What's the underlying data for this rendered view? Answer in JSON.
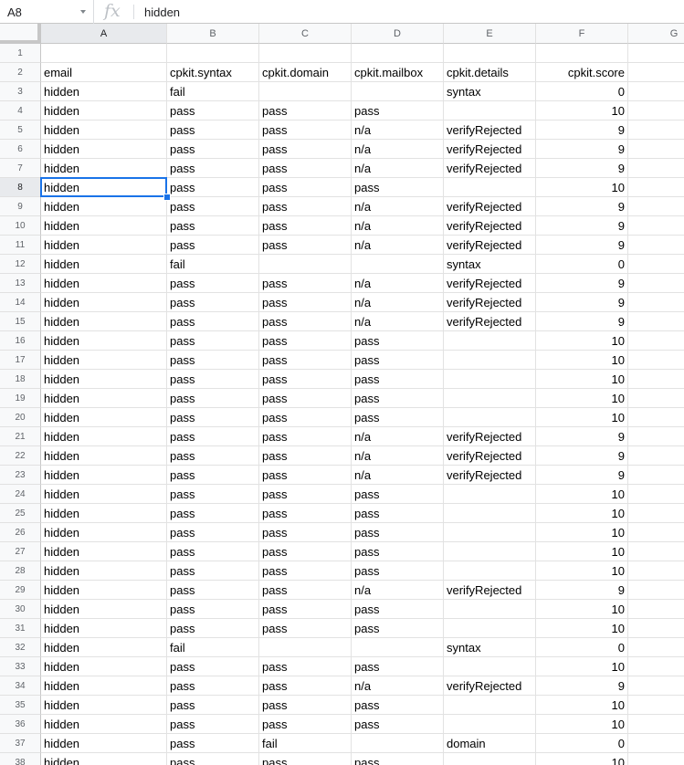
{
  "formula_bar": {
    "name_box": "A8",
    "fx_label": "fx",
    "value": "hidden"
  },
  "sheet": {
    "columns": [
      "A",
      "B",
      "C",
      "D",
      "E",
      "F",
      "G"
    ],
    "active_column": "A",
    "active_row": 8,
    "selected_cell": "A8",
    "rows": [
      {
        "n": "1",
        "cells": [
          "",
          "",
          "",
          "",
          "",
          ""
        ]
      },
      {
        "n": "2",
        "cells": [
          "email",
          "cpkit.syntax",
          "cpkit.domain",
          "cpkit.mailbox",
          "cpkit.details",
          "cpkit.score"
        ]
      },
      {
        "n": "3",
        "cells": [
          "hidden",
          "fail",
          "",
          "",
          "syntax",
          "0"
        ]
      },
      {
        "n": "4",
        "cells": [
          "hidden",
          "pass",
          "pass",
          "pass",
          "",
          "10"
        ]
      },
      {
        "n": "5",
        "cells": [
          "hidden",
          "pass",
          "pass",
          "n/a",
          "verifyRejected",
          "9"
        ]
      },
      {
        "n": "6",
        "cells": [
          "hidden",
          "pass",
          "pass",
          "n/a",
          "verifyRejected",
          "9"
        ]
      },
      {
        "n": "7",
        "cells": [
          "hidden",
          "pass",
          "pass",
          "n/a",
          "verifyRejected",
          "9"
        ]
      },
      {
        "n": "8",
        "cells": [
          "hidden",
          "pass",
          "pass",
          "pass",
          "",
          "10"
        ]
      },
      {
        "n": "9",
        "cells": [
          "hidden",
          "pass",
          "pass",
          "n/a",
          "verifyRejected",
          "9"
        ]
      },
      {
        "n": "10",
        "cells": [
          "hidden",
          "pass",
          "pass",
          "n/a",
          "verifyRejected",
          "9"
        ]
      },
      {
        "n": "11",
        "cells": [
          "hidden",
          "pass",
          "pass",
          "n/a",
          "verifyRejected",
          "9"
        ]
      },
      {
        "n": "12",
        "cells": [
          "hidden",
          "fail",
          "",
          "",
          "syntax",
          "0"
        ]
      },
      {
        "n": "13",
        "cells": [
          "hidden",
          "pass",
          "pass",
          "n/a",
          "verifyRejected",
          "9"
        ]
      },
      {
        "n": "14",
        "cells": [
          "hidden",
          "pass",
          "pass",
          "n/a",
          "verifyRejected",
          "9"
        ]
      },
      {
        "n": "15",
        "cells": [
          "hidden",
          "pass",
          "pass",
          "n/a",
          "verifyRejected",
          "9"
        ]
      },
      {
        "n": "16",
        "cells": [
          "hidden",
          "pass",
          "pass",
          "pass",
          "",
          "10"
        ]
      },
      {
        "n": "17",
        "cells": [
          "hidden",
          "pass",
          "pass",
          "pass",
          "",
          "10"
        ]
      },
      {
        "n": "18",
        "cells": [
          "hidden",
          "pass",
          "pass",
          "pass",
          "",
          "10"
        ]
      },
      {
        "n": "19",
        "cells": [
          "hidden",
          "pass",
          "pass",
          "pass",
          "",
          "10"
        ]
      },
      {
        "n": "20",
        "cells": [
          "hidden",
          "pass",
          "pass",
          "pass",
          "",
          "10"
        ]
      },
      {
        "n": "21",
        "cells": [
          "hidden",
          "pass",
          "pass",
          "n/a",
          "verifyRejected",
          "9"
        ]
      },
      {
        "n": "22",
        "cells": [
          "hidden",
          "pass",
          "pass",
          "n/a",
          "verifyRejected",
          "9"
        ]
      },
      {
        "n": "23",
        "cells": [
          "hidden",
          "pass",
          "pass",
          "n/a",
          "verifyRejected",
          "9"
        ]
      },
      {
        "n": "24",
        "cells": [
          "hidden",
          "pass",
          "pass",
          "pass",
          "",
          "10"
        ]
      },
      {
        "n": "25",
        "cells": [
          "hidden",
          "pass",
          "pass",
          "pass",
          "",
          "10"
        ]
      },
      {
        "n": "26",
        "cells": [
          "hidden",
          "pass",
          "pass",
          "pass",
          "",
          "10"
        ]
      },
      {
        "n": "27",
        "cells": [
          "hidden",
          "pass",
          "pass",
          "pass",
          "",
          "10"
        ]
      },
      {
        "n": "28",
        "cells": [
          "hidden",
          "pass",
          "pass",
          "pass",
          "",
          "10"
        ]
      },
      {
        "n": "29",
        "cells": [
          "hidden",
          "pass",
          "pass",
          "n/a",
          "verifyRejected",
          "9"
        ]
      },
      {
        "n": "30",
        "cells": [
          "hidden",
          "pass",
          "pass",
          "pass",
          "",
          "10"
        ]
      },
      {
        "n": "31",
        "cells": [
          "hidden",
          "pass",
          "pass",
          "pass",
          "",
          "10"
        ]
      },
      {
        "n": "32",
        "cells": [
          "hidden",
          "fail",
          "",
          "",
          "syntax",
          "0"
        ]
      },
      {
        "n": "33",
        "cells": [
          "hidden",
          "pass",
          "pass",
          "pass",
          "",
          "10"
        ]
      },
      {
        "n": "34",
        "cells": [
          "hidden",
          "pass",
          "pass",
          "n/a",
          "verifyRejected",
          "9"
        ]
      },
      {
        "n": "35",
        "cells": [
          "hidden",
          "pass",
          "pass",
          "pass",
          "",
          "10"
        ]
      },
      {
        "n": "36",
        "cells": [
          "hidden",
          "pass",
          "pass",
          "pass",
          "",
          "10"
        ]
      },
      {
        "n": "37",
        "cells": [
          "hidden",
          "pass",
          "fail",
          "",
          "domain",
          "0"
        ]
      },
      {
        "n": "38",
        "cells": [
          "hidden",
          "pass",
          "pass",
          "pass",
          "",
          "10"
        ]
      }
    ]
  },
  "colors": {
    "selection": "#1a73e8",
    "header_bg": "#f8f9fa",
    "header_active_bg": "#e8eaed",
    "gridline": "#e2e2e2"
  }
}
